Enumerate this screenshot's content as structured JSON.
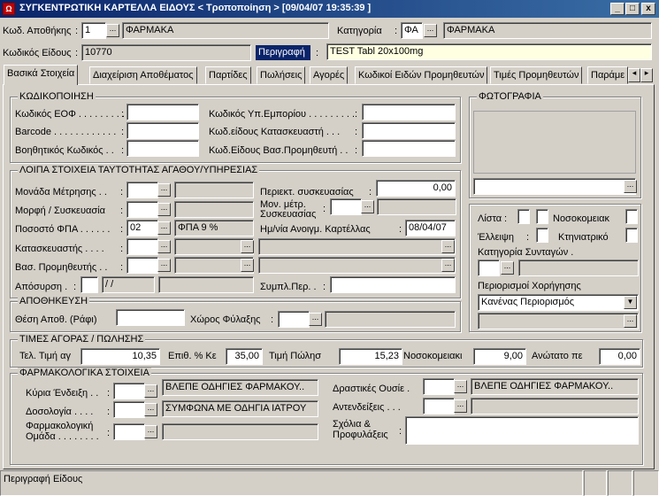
{
  "window": {
    "title": "ΣΥΓΚΕΝΤΡΩΤΙΚΗ ΚΑΡΤΕΛΛΑ ΕΙΔΟΥΣ < Τροποποίηση >   [09/04/07 19:35:39 ]",
    "minimize": "_",
    "maximize": "□",
    "close": "x"
  },
  "header": {
    "warehouse_label": "Κωδ. Αποθήκης",
    "warehouse_code": "1",
    "warehouse_name": "ΦΑΡΜΑΚΑ",
    "category_label": "Κατηγορία",
    "category_code": "ΦΑ",
    "category_name": "ΦΑΡΜΑΚΑ",
    "item_code_label": "Κωδικός Είδους",
    "item_code": "10770",
    "description_label": "Περιγραφή",
    "description": "TEST Tabl 20x100mg"
  },
  "tabs": [
    "Βασικά Στοιχεία",
    "Διαχείριση Αποθέματος",
    "Παρτίδες",
    "Πωλήσεις",
    "Αγορές",
    "Κωδικοί Ειδών Προμηθευτών",
    "Τιμές Προμηθευτών",
    "Παράμε"
  ],
  "coding": {
    "title": "ΚΩΔΙΚΟΠΟΙΗΣΗ",
    "eof": "Κωδικός ΕΟΦ . . . . . . . . .",
    "barcode": "Barcode . . . . . . . . . . . .",
    "aux": "Βοηθητικός Κωδικός . .",
    "trade_code": "Κωδικός Υπ.Εμπορίου . . . . . . . . .",
    "mfr_code": "Κωδ.είδους Κατασκευαστή . . .",
    "supplier_code": "Κωδ.Είδους Βασ.Προμηθευτή . ."
  },
  "identity": {
    "title": "ΛΟΙΠΑ ΣΤΟΙΧΕΙΑ ΤΑΥΤΟΤΗΤΑΣ ΑΓΑΘΟΥ/ΥΠΗΡΕΣΙΑΣ",
    "unit": "Μονάδα Μέτρησης . .",
    "form": "Μορφή / Συσκευασία",
    "vat": "Ποσοστό ΦΠΑ . . . . . .",
    "vat_code": "02",
    "vat_text": "ΦΠΑ  9 %",
    "manufacturer": "Κατασκευαστής . . . .",
    "main_supplier": "Βασ. Προμηθευτής . .",
    "withdrawal": "Απόσυρση .",
    "withdrawal_date": "/  /",
    "pack_content": "Περιεκτ. συσκευασίας",
    "pack_content_val": "0,00",
    "pack_unit": "Μον. μέτρ. Συσκευασίας",
    "open_date_label": "Ημ/νία Ανοιγμ. Καρτέλλας",
    "open_date": "08/04/07",
    "compl_pack": "Συμπλ.Περ. ."
  },
  "photo": {
    "title": "ΦΩΤΟΓΡΑΦΙΑ"
  },
  "flags": {
    "list": "Λίστα",
    "hospital": "Νοσοκομειακ",
    "shortage": "Έλλειψη",
    "veterinary": "Κτηνιατρικό",
    "rx_category": "Κατηγορία Συνταγών .",
    "restrictions": "Περιορισμοί Χορήγησης",
    "restriction_value": "Κανένας Περιορισμός"
  },
  "storage": {
    "title": "ΑΠΟΘΗΚΕΥΣΗ",
    "position": "Θέση Αποθ. (Ράφι)",
    "space": "Χώρος Φύλαξης"
  },
  "prices": {
    "title": "ΤΙΜΕΣ ΑΓΟΡΑΣ / ΠΩΛΗΣΗΣ",
    "last_buy": "Τελ. Τιμή αγ",
    "last_buy_val": "10,35",
    "markup": "Επιθ. % Κε",
    "markup_val": "35,00",
    "sell": "Τιμή Πώλησ",
    "sell_val": "15,23",
    "hospital": "Νοσοκομειακι",
    "hospital_val": "9,00",
    "max": "Ανώτατο πε",
    "max_val": "0,00"
  },
  "pharma": {
    "title": "ΦΑΡΜΑΚΟΛΟΓΙΚΑ ΣΤΟΙΧΕΙΑ",
    "indication": "Κύρια Ένδειξη . .",
    "indication_val": "ΒΛΕΠΕ ΟΔΗΓΙΕΣ ΦΑΡΜΑΚΟΥ..",
    "dosage": "Δοσολογία . . . .",
    "dosage_val": "ΣΥΜΦΩΝΑ ΜΕ ΟΔΗΓΙΑ ΙΑΤΡΟΥ",
    "group": "Φαρμακολογική Ομάδα . . . . . . . .",
    "active": "Δραστικές Ουσίε .",
    "active_val": "ΒΛΕΠΕ ΟΔΗΓΙΕΣ ΦΑΡΜΑΚΟΥ..",
    "contra": "Αντενδείξεις . . .",
    "comments": "Σχόλια & Προφυλάξεις"
  },
  "status": {
    "text": "Περιγραφή Είδους"
  }
}
